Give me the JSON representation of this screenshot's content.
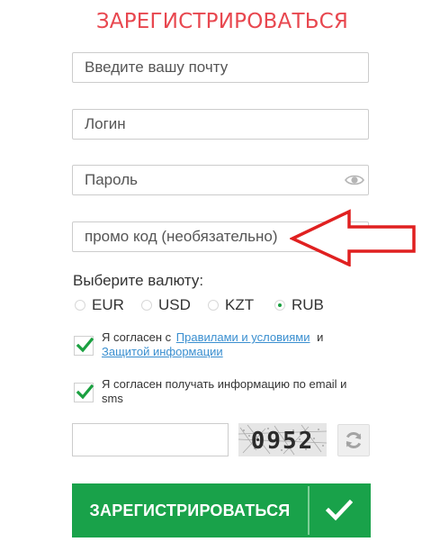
{
  "form": {
    "title": "ЗАРЕГИСТРИРОВАТЬСЯ",
    "email_placeholder": "Введите вашу почту",
    "login_placeholder": "Логин",
    "password_placeholder": "Пароль",
    "promo_placeholder": "промо код (необязательно)",
    "password_toggle_icon": "eye-icon"
  },
  "currency": {
    "label": "Выберите валюту:",
    "selected": "RUB",
    "options": [
      "EUR",
      "USD",
      "KZT",
      "RUB"
    ]
  },
  "terms": {
    "text_before": "Я согласен с",
    "rules_link": "Правилами и условиями",
    "joiner": "и",
    "privacy_link": "Защитой информации",
    "checked": true
  },
  "newsletter": {
    "text": "Я согласен получать информацию по email и sms",
    "checked": true
  },
  "captcha": {
    "code": "0952",
    "input_value": "",
    "refresh_icon": "refresh-icon"
  },
  "submit": {
    "label": "ЗАРЕГИСТРИРОВАТЬСЯ",
    "icon": "checkmark-icon"
  },
  "colors": {
    "title": "#e8474f",
    "accent_green": "#19a24a",
    "link": "#3a8fd0",
    "arrow": "#e02020"
  }
}
